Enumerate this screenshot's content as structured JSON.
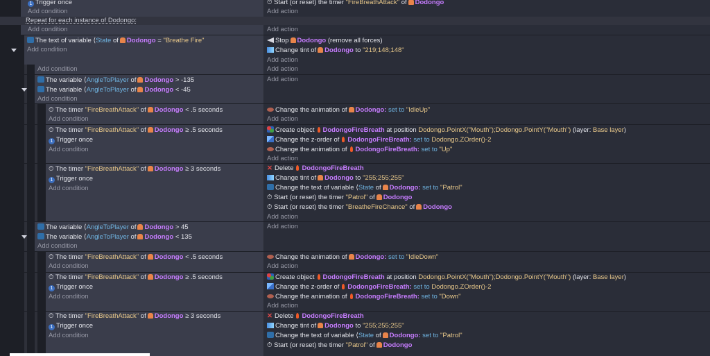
{
  "t": {
    "trigger_once": "Trigger once",
    "add_condition": "Add condition",
    "add_action": "Add action",
    "start_timer": "Start (or reset) the timer",
    "of": "of",
    "repeat": "Repeat for each instance of Dodongo:",
    "text_of_variable": "The text of variable",
    "the_variable": "The variable",
    "the_timer": "The timer",
    "seconds": "seconds",
    "stop": "Stop",
    "remove_forces": "(remove all forces)",
    "change_tint": "Change tint of",
    "to": "to",
    "change_anim": "Change the animation of",
    "set_to": "set to",
    "create_object": "Create object",
    "at_position": "at position",
    "layer": "(layer:",
    "base_layer": "Base layer",
    "close_paren": ")",
    "change_z": "Change the z-order of",
    "delete": "Delete",
    "change_text_var": "Change the text of variable"
  },
  "names": {
    "dodongo": "Dodongo",
    "fire": "DodongoFireBreath",
    "colon_dodongo": "Dodongo:",
    "colon_fire": "DodongoFireBreath:",
    "state": "State",
    "angle": "AngleToPlayer",
    "timer": "\"FireBreathAttack\"",
    "timer_patrol": "\"Patrol\"",
    "timer_chance": "\"BreatheFireChance\""
  },
  "values": {
    "breathe_fire": "\"Breathe Fire\"",
    "tint_red": "\"219;148;148\"",
    "tint_white": "\"255;255;255\"",
    "patrol": "\"Patrol\"",
    "idle_up": "\"IdleUp\"",
    "idle_down": "\"IdleDown\"",
    "up": "\"Up\"",
    "down": "\"Down\"",
    "pos": "Dodongo.PointX(\"Mouth\");Dodongo.PointY(\"Mouth\")",
    "zorder": "Dodongo.ZOrder()-2",
    "eq": "=",
    "gt": ">",
    "lt": "<",
    "ge": "≥",
    "n135": "-135",
    "n45": "-45",
    "p45": "45",
    "p135": "135",
    "half": ".5",
    "three": "3"
  }
}
